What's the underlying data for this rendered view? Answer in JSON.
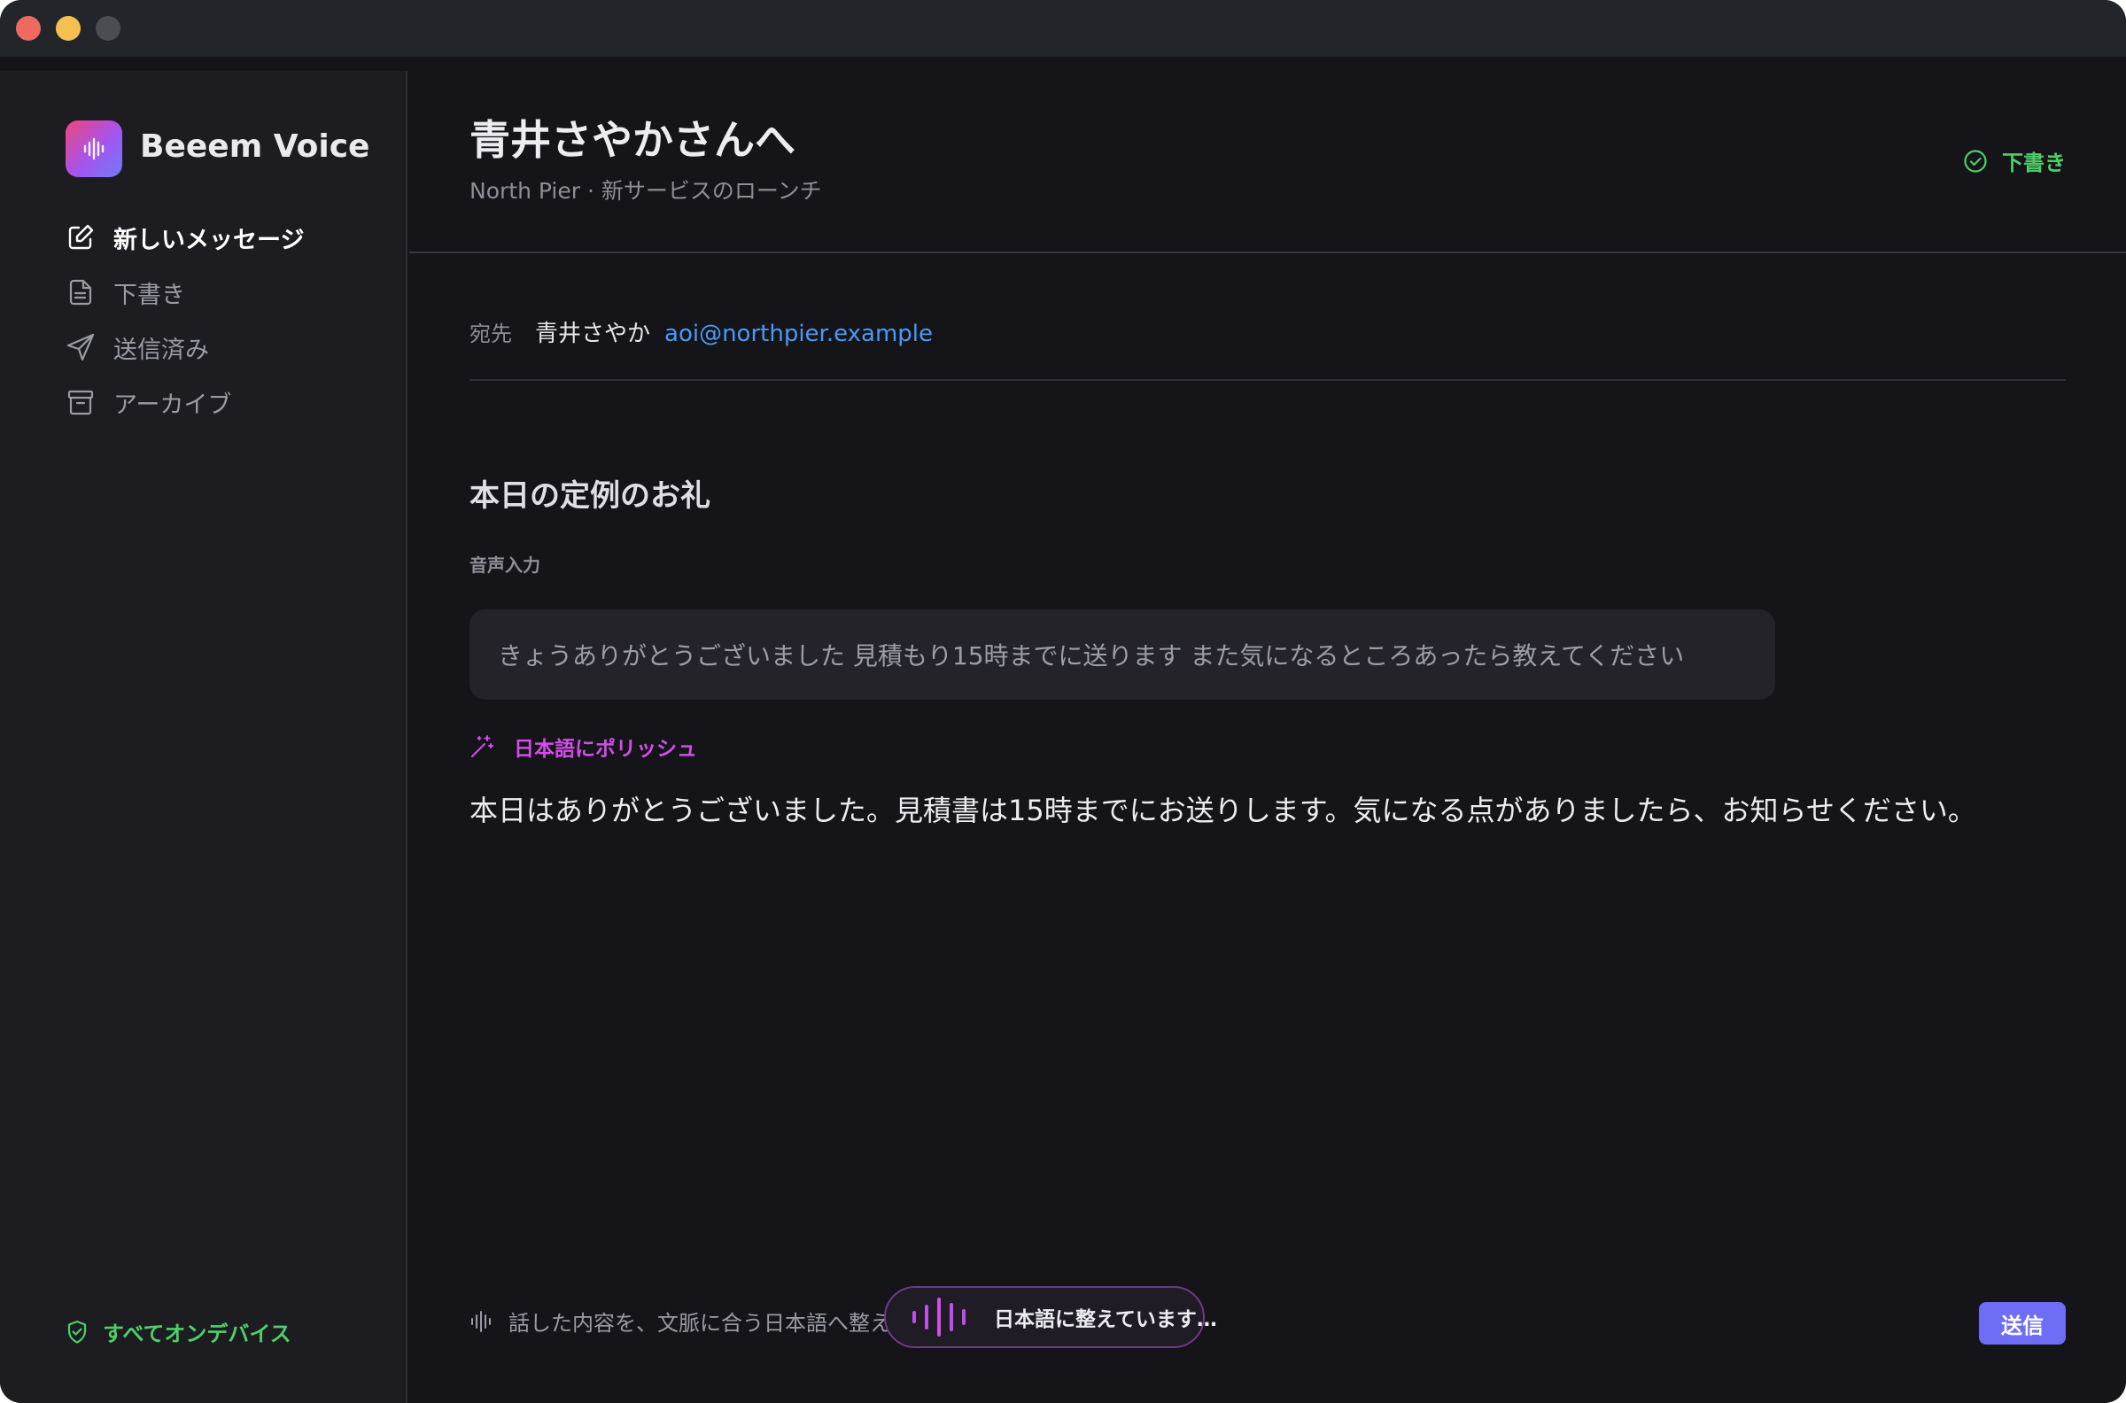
{
  "app": {
    "name": "Beeem Voice"
  },
  "sidebar": {
    "items": [
      {
        "label": "新しいメッセージ",
        "icon": "compose-icon",
        "active": true
      },
      {
        "label": "下書き",
        "icon": "document-icon",
        "active": false
      },
      {
        "label": "送信済み",
        "icon": "send-icon",
        "active": false
      },
      {
        "label": "アーカイブ",
        "icon": "archive-icon",
        "active": false
      }
    ],
    "footer_label": "すべてオンデバイス"
  },
  "header": {
    "title": "青井さやかさんへ",
    "subtitle": "North Pier · 新サービスのローンチ",
    "status_label": "下書き"
  },
  "message": {
    "to_label": "宛先",
    "recipient_name": "青井さやか",
    "recipient_email": "aoi@northpier.example",
    "subject": "本日の定例のお礼",
    "voice_section_label": "音声入力",
    "raw_transcript": "きょうありがとうございました 見積もり15時までに送ります また気になるところあったら教えてください",
    "polish_label": "日本語にポリッシュ",
    "polished_text": "本日はありがとうございました。見積書は15時までにお送りします。気になる点がありましたら、お知らせください。"
  },
  "footer": {
    "hint": "話した内容を、文脈に合う日本語へ整え",
    "processing_label": "日本語に整えています…",
    "send_label": "送信"
  },
  "colors": {
    "accent_green": "#4dcf68",
    "accent_magenta": "#d24ee8",
    "link_blue": "#4a9af4",
    "send_button": "#6d6df6",
    "background": "#151419",
    "sidebar": "#1c1c21"
  }
}
